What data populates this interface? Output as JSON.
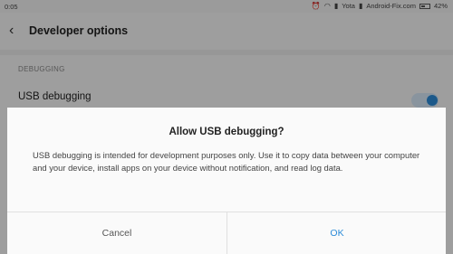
{
  "status_bar": {
    "time": "0:05",
    "carrier": "Yota",
    "watermark": "Android-Fix.com",
    "battery": "42%",
    "icons": [
      "alarm-icon",
      "wifi-icon",
      "signal-icon",
      "signal-icon",
      "battery-icon"
    ]
  },
  "app_bar": {
    "title": "Developer options"
  },
  "settings": {
    "section_header": "DEBUGGING",
    "usb_debugging_label": "USB debugging",
    "usb_debugging_enabled": true
  },
  "dialog": {
    "title": "Allow USB debugging?",
    "message": "USB debugging is intended for development purposes only. Use it to copy data between your computer and your device, install apps on your device without notification, and read log data.",
    "cancel_label": "Cancel",
    "ok_label": "OK"
  },
  "colors": {
    "accent": "#2c8bd8",
    "dialog_bg": "#fafafa",
    "scrim": "rgba(0,0,0,0.36)"
  }
}
